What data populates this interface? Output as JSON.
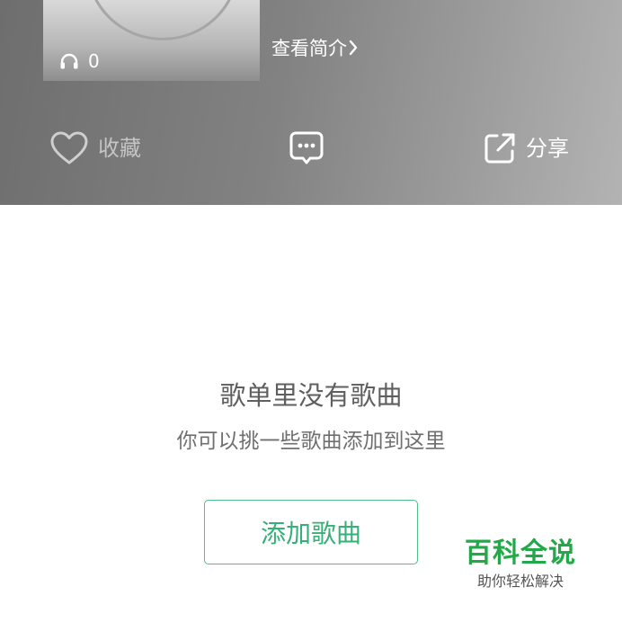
{
  "header": {
    "play_count": "0",
    "intro_link": "查看简介"
  },
  "actions": {
    "favorite_label": "收藏",
    "share_label": "分享"
  },
  "empty_state": {
    "title": "歌单里没有歌曲",
    "subtitle": "你可以挑一些歌曲添加到这里",
    "add_button": "添加歌曲"
  },
  "watermark": {
    "title": "百科全说",
    "subtitle": "助你轻松解决"
  },
  "colors": {
    "accent_green": "#35b077",
    "header_gray": "#828282",
    "watermark_green": "#22a848"
  },
  "icons": [
    "headphones-icon",
    "chevron-right-icon",
    "heart-icon",
    "comment-icon",
    "share-icon"
  ]
}
